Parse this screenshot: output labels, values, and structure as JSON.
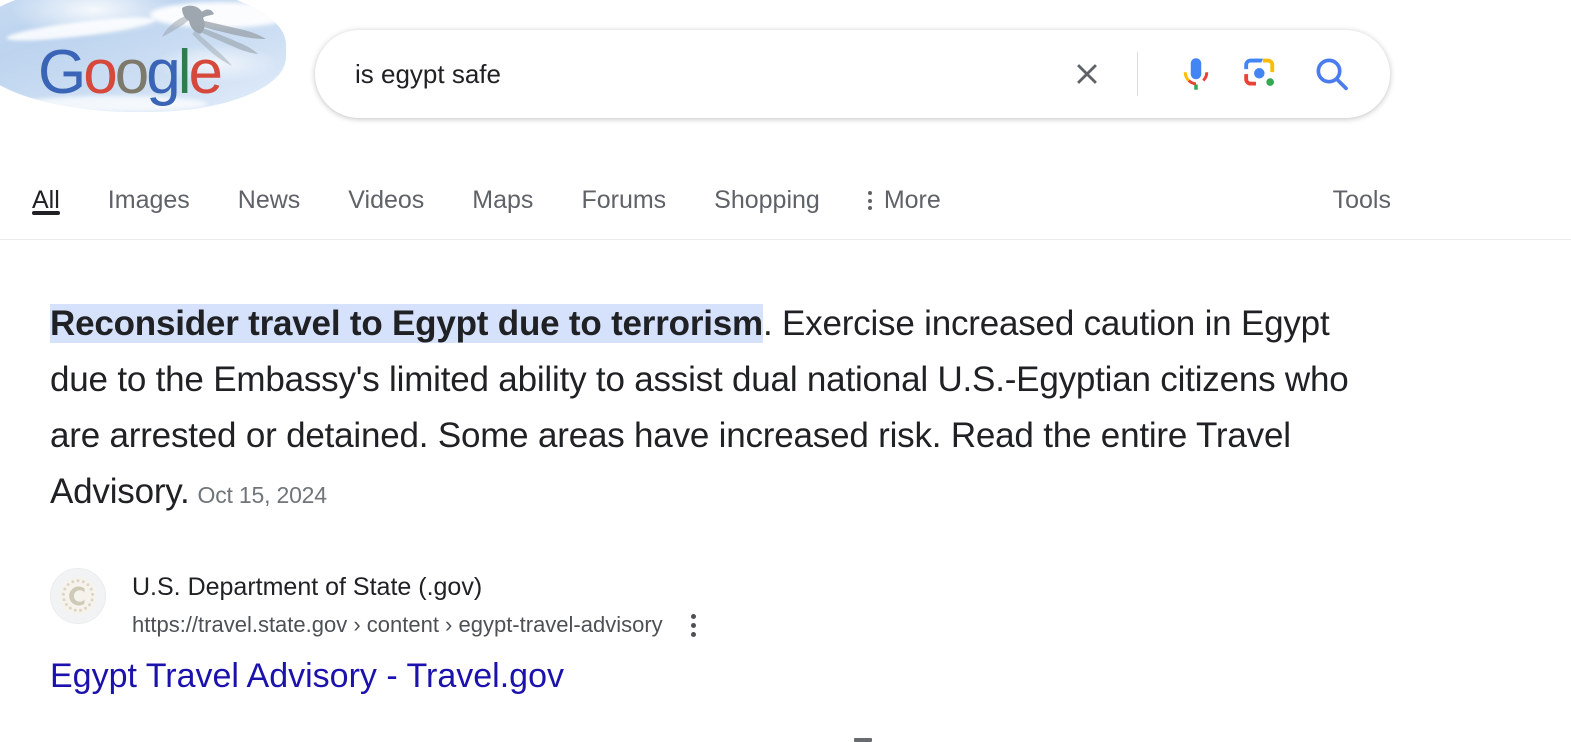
{
  "branding": {
    "logo_text": "Google",
    "logo_letters": [
      "G",
      "o",
      "o",
      "g",
      "l",
      "e"
    ],
    "doodle_description": "sky-with-bird-doodle",
    "colors": {
      "blue": "#3a64b5",
      "red": "#d6483b",
      "yellow": "#7d7a6b",
      "green": "#2f7d4e",
      "grey": "#6b6b63"
    }
  },
  "search": {
    "query": "is egypt safe",
    "placeholder": "Search",
    "clear_label": "Clear",
    "voice_label": "Search by voice",
    "lens_label": "Search by image",
    "submit_label": "Google Search"
  },
  "tabs": [
    {
      "label": "All",
      "active": true
    },
    {
      "label": "Images",
      "active": false
    },
    {
      "label": "News",
      "active": false
    },
    {
      "label": "Videos",
      "active": false
    },
    {
      "label": "Maps",
      "active": false
    },
    {
      "label": "Forums",
      "active": false
    },
    {
      "label": "Shopping",
      "active": false
    }
  ],
  "more_label": "More",
  "tools_label": "Tools",
  "featured_snippet": {
    "highlighted": "Reconsider travel to Egypt due to terrorism",
    "rest": ". Exercise increased caution in Egypt due to the Embassy's limited ability to assist dual national U.S.-Egyptian citizens who are arrested or detained. Some areas have increased risk. Read the entire Travel Advisory.",
    "date": "Oct 15, 2024",
    "highlight_color": "#d6e2fb"
  },
  "source": {
    "site_name": "U.S. Department of State (.gov)",
    "url": "https://travel.state.gov › content › egypt-travel-advisory",
    "favicon_label": "us-state-department-seal",
    "menu_label": "About this result"
  },
  "result_title": {
    "text": "Egypt Travel Advisory - Travel.gov",
    "color": "#1b12ad"
  }
}
